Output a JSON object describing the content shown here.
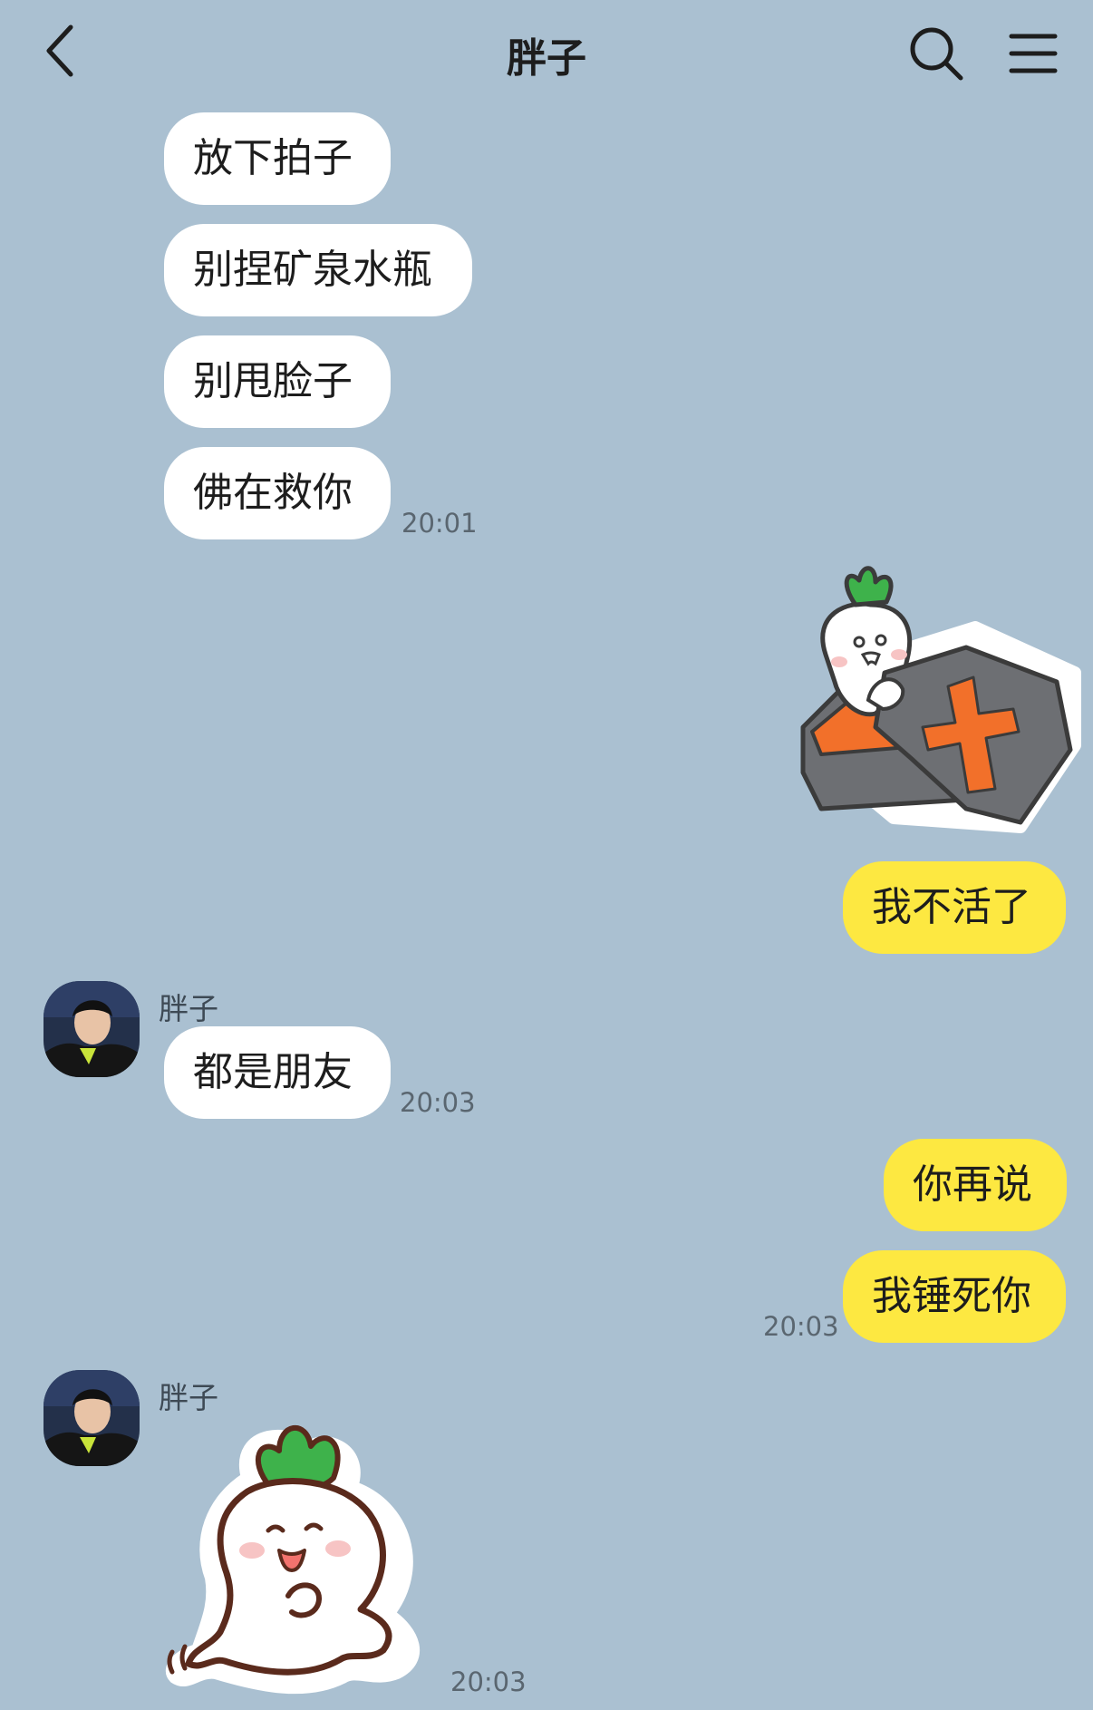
{
  "header": {
    "title": "胖子",
    "back_icon": "chevron-left-icon",
    "search_icon": "search-icon",
    "menu_icon": "hamburger-menu-icon"
  },
  "messages": [
    {
      "direction": "in",
      "text": "放下拍子"
    },
    {
      "direction": "in",
      "text": "别捏矿泉水瓶"
    },
    {
      "direction": "in",
      "text": "别甩脸子"
    },
    {
      "direction": "in",
      "text": "佛在救你",
      "time": "20:01"
    },
    {
      "direction": "out",
      "type": "sticker",
      "sticker": "radish-coffin-sticker"
    },
    {
      "direction": "out",
      "text": "我不活了"
    },
    {
      "direction": "in",
      "sender": "胖子",
      "text": "都是朋友",
      "time": "20:03"
    },
    {
      "direction": "out",
      "text": "你再说"
    },
    {
      "direction": "out",
      "text": "我锤死你",
      "time": "20:03"
    },
    {
      "direction": "in",
      "sender": "胖子",
      "type": "sticker",
      "sticker": "radish-ghost-sticker",
      "time": "20:03"
    }
  ],
  "colors": {
    "background": "#aac0d1",
    "incoming_bubble": "#ffffff",
    "outgoing_bubble": "#fde841"
  }
}
